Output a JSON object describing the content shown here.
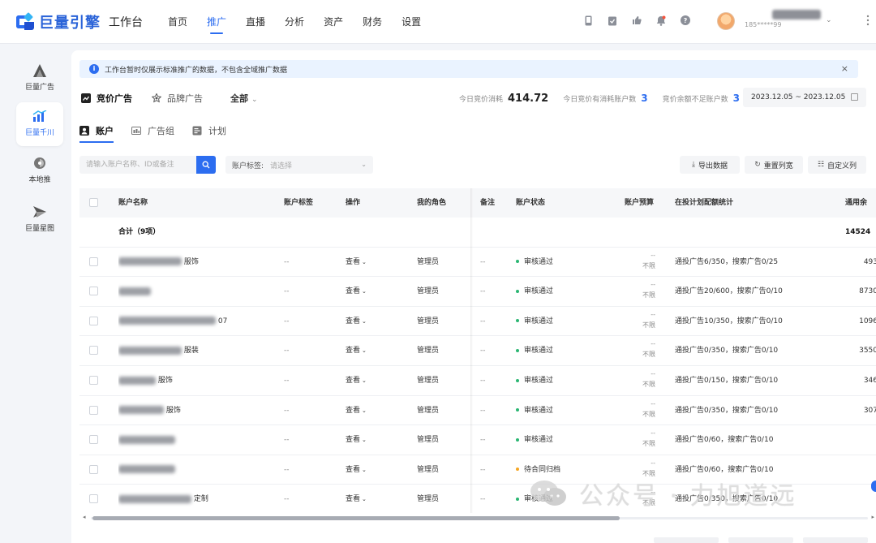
{
  "app": {
    "logo_text": "巨量引擎",
    "subtitle": "工作台"
  },
  "nav": {
    "items": [
      "首页",
      "推广",
      "直播",
      "分析",
      "资产",
      "财务",
      "设置"
    ],
    "active": "推广"
  },
  "topicons": [
    "phone-icon",
    "clipboard-icon",
    "thumb-icon",
    "bell-icon",
    "help-icon"
  ],
  "user": {
    "phone": "185*****99"
  },
  "sidebar": [
    {
      "label": "巨量广告",
      "icon": "ad-platform-icon"
    },
    {
      "label": "巨量千川",
      "icon": "qianchuan-icon",
      "active": true
    },
    {
      "label": "本地推",
      "icon": "local-push-icon"
    },
    {
      "label": "巨量星图",
      "icon": "xingtu-icon"
    }
  ],
  "notice": {
    "text": "工作台暂时仅展示标准推广的数据，不包含全域推广数据",
    "close": "×"
  },
  "typebar": {
    "bidding": "竞价广告",
    "brand": "品牌广告",
    "all": "全部",
    "caret": "⌄"
  },
  "stats": {
    "spend_label": "今日竞价消耗",
    "spend_value": "414.72",
    "active_label": "今日竞价有消耗账户数",
    "active_value": "3",
    "low_label": "竞价余额不足账户数",
    "low_value": "3"
  },
  "daterange": "2023.12.05 ~ 2023.12.05",
  "tabs": [
    "账户",
    "广告组",
    "计划"
  ],
  "filters": {
    "search_placeholder": "请输入账户名称、ID或备注",
    "tag_label": "账户标签:",
    "tag_placeholder": "请选择",
    "export": "导出数据",
    "reset": "重置列宽",
    "customize": "自定义列"
  },
  "table": {
    "headers": [
      "账户名称",
      "账户标签",
      "操作",
      "我的角色",
      "备注",
      "账户状态",
      "账户预算",
      "在投计划配额统计",
      "通用余"
    ],
    "summary": {
      "label": "合计（9项）",
      "balance": "14524"
    },
    "rows": [
      {
        "name": "服饰",
        "tag": "--",
        "op": "查看",
        "role": "管理员",
        "note": "--",
        "status": "审核通过",
        "status_color": "#2bb673",
        "budget_top": "--",
        "budget_bottom": "不限",
        "quota": "通投广告6/350，搜索广告0/25",
        "balance": "493"
      },
      {
        "name": "",
        "tag": "--",
        "op": "查看",
        "role": "管理员",
        "note": "--",
        "status": "审核通过",
        "status_color": "#2bb673",
        "budget_top": "--",
        "budget_bottom": "不限",
        "quota": "通投广告20/600，搜索广告0/10",
        "balance": "8730"
      },
      {
        "name": "07",
        "tag": "--",
        "op": "查看",
        "role": "管理员",
        "note": "--",
        "status": "审核通过",
        "status_color": "#2bb673",
        "budget_top": "--",
        "budget_bottom": "不限",
        "quota": "通投广告10/350，搜索广告0/10",
        "balance": "1096"
      },
      {
        "name": "服装",
        "tag": "--",
        "op": "查看",
        "role": "管理员",
        "note": "--",
        "status": "审核通过",
        "status_color": "#2bb673",
        "budget_top": "--",
        "budget_bottom": "不限",
        "quota": "通投广告0/350，搜索广告0/10",
        "balance": "3550"
      },
      {
        "name": "服饰",
        "tag": "--",
        "op": "查看",
        "role": "管理员",
        "note": "--",
        "status": "审核通过",
        "status_color": "#2bb673",
        "budget_top": "--",
        "budget_bottom": "不限",
        "quota": "通投广告0/150，搜索广告0/10",
        "balance": "346"
      },
      {
        "name": "服饰",
        "tag": "--",
        "op": "查看",
        "role": "管理员",
        "note": "--",
        "status": "审核通过",
        "status_color": "#2bb673",
        "budget_top": "--",
        "budget_bottom": "不限",
        "quota": "通投广告0/350，搜索广告0/10",
        "balance": "307"
      },
      {
        "name": "",
        "tag": "--",
        "op": "查看",
        "role": "管理员",
        "note": "--",
        "status": "审核通过",
        "status_color": "#2bb673",
        "budget_top": "--",
        "budget_bottom": "不限",
        "quota": "通投广告0/60，搜索广告0/10",
        "balance": ""
      },
      {
        "name": "",
        "tag": "--",
        "op": "查看",
        "role": "管理员",
        "note": "--",
        "status": "待合同归档",
        "status_color": "#f5a623",
        "budget_top": "--",
        "budget_bottom": "不限",
        "quota": "通投广告0/60，搜索广告0/10",
        "balance": ""
      },
      {
        "name": "定制",
        "tag": "--",
        "op": "查看",
        "role": "管理员",
        "note": "--",
        "status": "审核通过",
        "status_color": "#2bb673",
        "budget_top": "--",
        "budget_bottom": "不限",
        "quota": "通投广告0/350，搜索广告0/10",
        "balance": ""
      }
    ]
  },
  "watermark": "公众号 · 力旭道远",
  "colors": {
    "accent": "#2c6df0",
    "success": "#2bb673",
    "warning": "#f5a623"
  }
}
